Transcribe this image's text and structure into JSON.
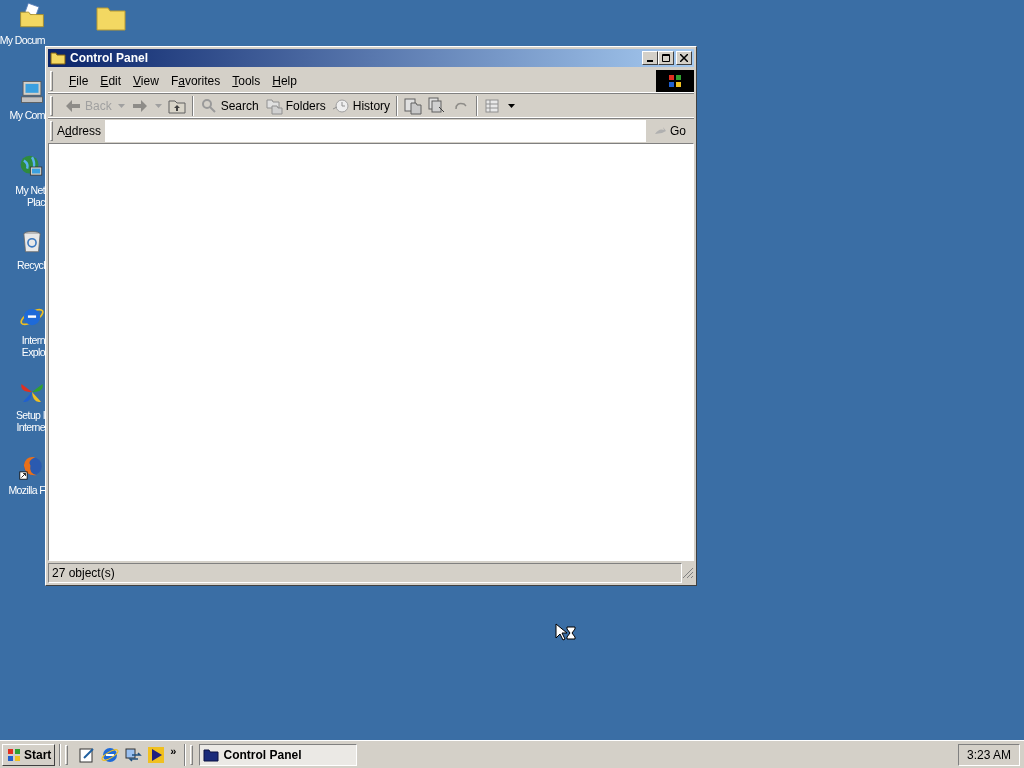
{
  "desktop_icons": [
    {
      "kind": "documents",
      "lines": [
        "My Docum"
      ]
    },
    {
      "kind": "computer",
      "lines": [
        "My Com"
      ]
    },
    {
      "kind": "network",
      "lines": [
        "My Net",
        "Plac"
      ]
    },
    {
      "kind": "recycle",
      "lines": [
        "Recycl"
      ]
    },
    {
      "kind": "ie",
      "lines": [
        "Intern",
        "Explo"
      ]
    },
    {
      "kind": "setup",
      "lines": [
        "Setup I",
        "Interne"
      ]
    },
    {
      "kind": "firefox",
      "lines": [
        "Mozilla F"
      ]
    }
  ],
  "desktop_extra_icon": {
    "kind": "folder"
  },
  "window": {
    "title": "Control Panel",
    "menu": [
      {
        "key": "F",
        "after": "ile"
      },
      {
        "key": "E",
        "after": "dit"
      },
      {
        "key": "V",
        "after": "iew"
      },
      {
        "before": "F",
        "key": "a",
        "after": "vorites"
      },
      {
        "key": "T",
        "after": "ools"
      },
      {
        "key": "H",
        "after": "elp"
      }
    ],
    "toolbar": [
      {
        "kind": "back",
        "label": "Back",
        "disabled": true
      },
      {
        "kind": "forward",
        "disabled": true
      },
      {
        "kind": "up",
        "disabled": false
      },
      {
        "kind": "separator"
      },
      {
        "kind": "search",
        "label": "Search",
        "disabled": false
      },
      {
        "kind": "folders",
        "label": "Folders",
        "disabled": false
      },
      {
        "kind": "history",
        "label": "History",
        "disabled": false
      },
      {
        "kind": "separator"
      },
      {
        "kind": "moveto",
        "disabled": false
      },
      {
        "kind": "copyto",
        "disabled": false
      },
      {
        "kind": "undo",
        "disabled": true
      },
      {
        "kind": "separator"
      },
      {
        "kind": "views",
        "disabled": false
      }
    ],
    "address": {
      "label_before": "A",
      "label_key": "d",
      "label_after": "dress",
      "go": "Go"
    },
    "status_bar": "27 object(s)"
  },
  "taskbar": {
    "start": "Start",
    "quick_launch": [
      {
        "kind": "edit"
      },
      {
        "kind": "ie"
      },
      {
        "kind": "sync"
      },
      {
        "kind": "media"
      }
    ],
    "chevron": "»",
    "tasks": [
      {
        "label": "Control Panel",
        "selected": true
      }
    ],
    "clock": "3:23 AM"
  }
}
